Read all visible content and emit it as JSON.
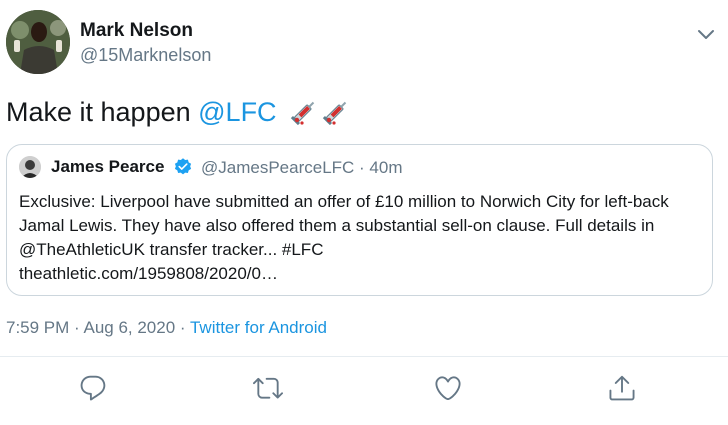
{
  "author": {
    "name": "Mark Nelson",
    "handle": "@15Marknelson"
  },
  "tweet": {
    "text": "Make it happen",
    "mention": "@LFC",
    "emoji": "syringe-blood-drops-emoji"
  },
  "quoted_tweet": {
    "name": "James Pearce",
    "handle": "@JamesPearceLFC · 40m",
    "verified": true,
    "body": "Exclusive: Liverpool have submitted an offer of £10 million to Norwich City for left-back Jamal Lewis. They have also offered them a substantial sell-on clause. Full details in @TheAthleticUK transfer tracker... #LFC",
    "link": "theathletic.com/1959808/2020/0…"
  },
  "meta": {
    "timestamp": "7:59 PM · Aug 6, 2020 · ",
    "source": "Twitter for Android"
  },
  "actions": {
    "icons": [
      "reply-icon",
      "retweet-icon",
      "like-icon",
      "share-icon"
    ]
  },
  "colors": {
    "accent": "#1b95e0",
    "secondary_text": "#657786",
    "border": "#ccd6dd"
  }
}
